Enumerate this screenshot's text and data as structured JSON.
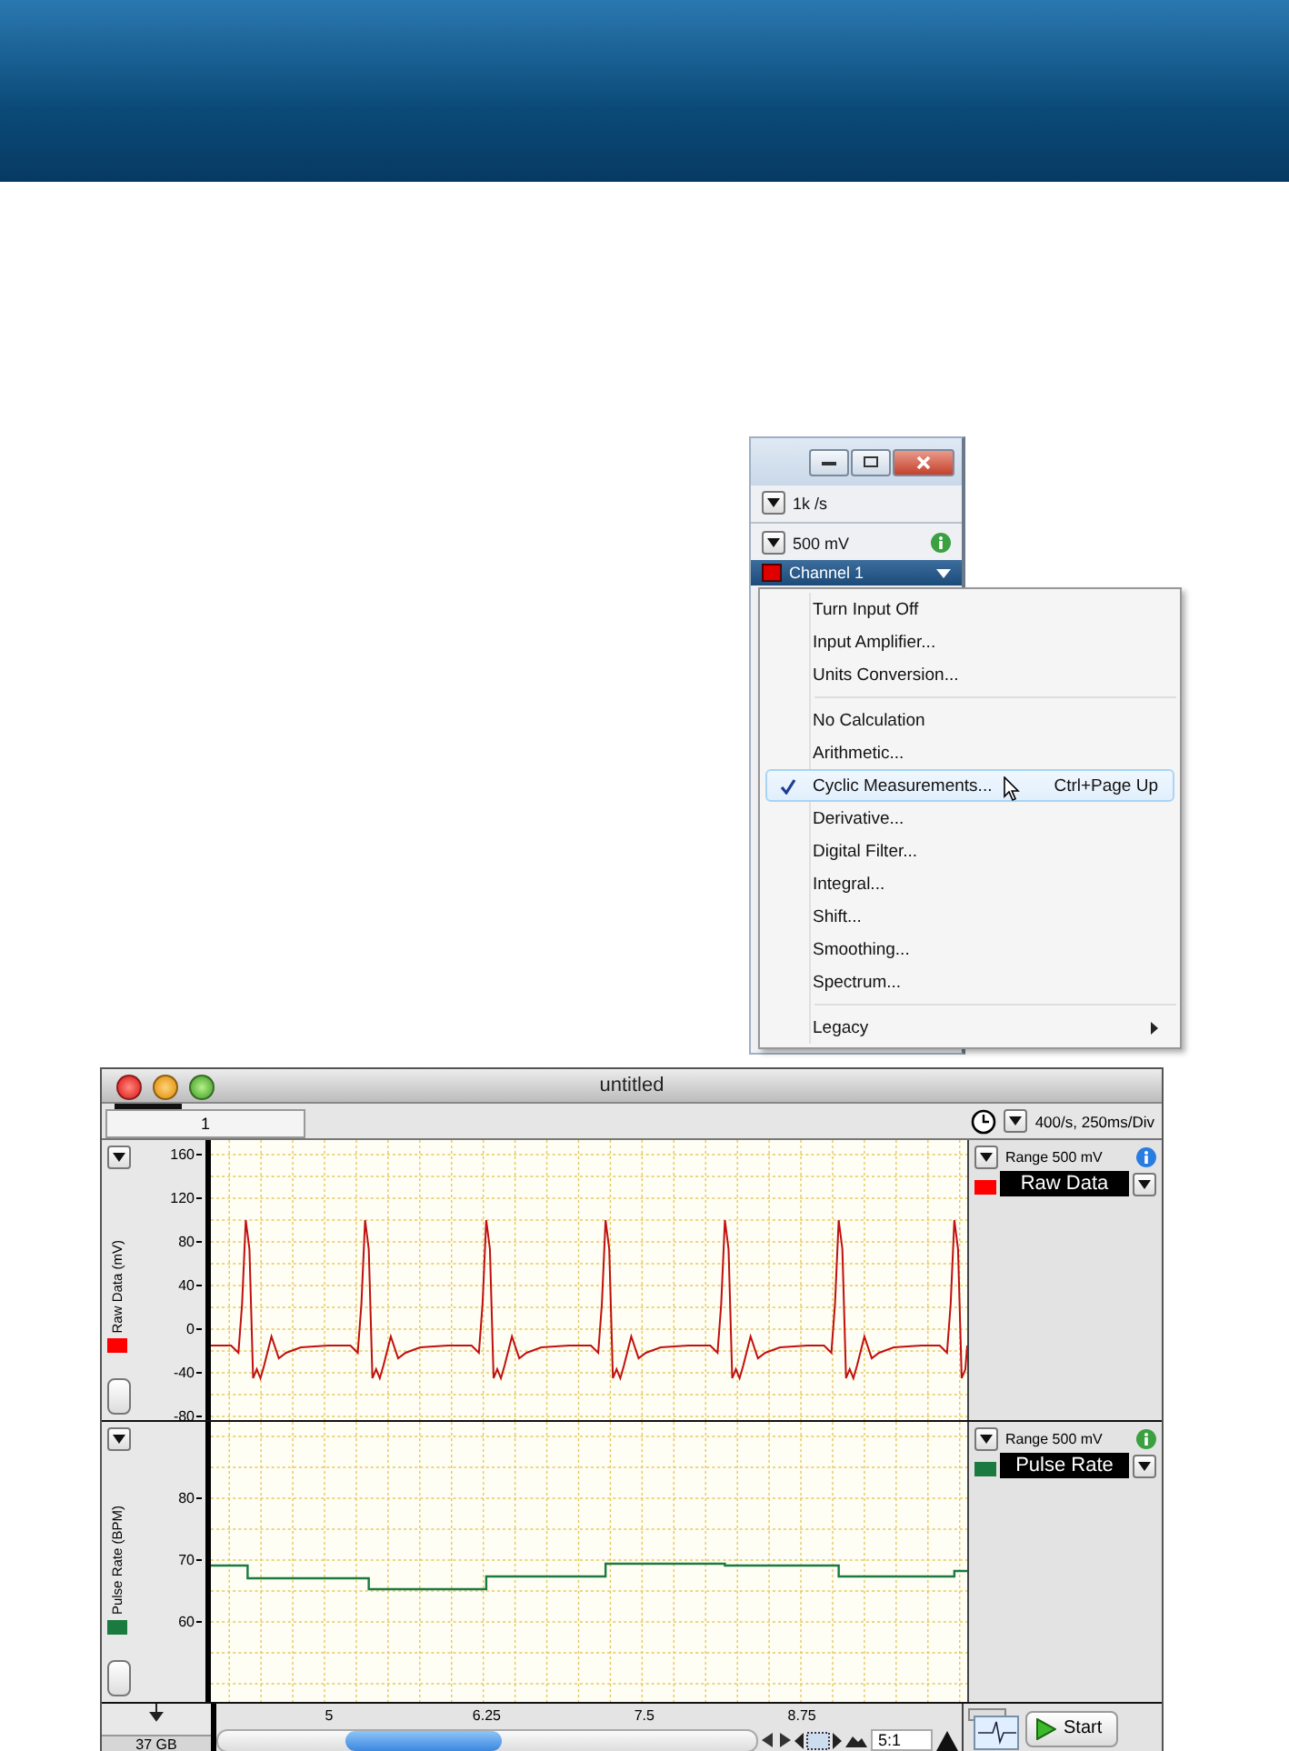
{
  "channel_panel": {
    "sample_rate": "1k /s",
    "range": "500 mV",
    "channel": {
      "name": "Channel 1",
      "color": "#e00000"
    }
  },
  "context_menu": {
    "groups": [
      [
        {
          "label": "Turn Input Off",
          "checked": false,
          "selected": false,
          "submenu": false
        },
        {
          "label": "Input Amplifier...",
          "checked": false,
          "selected": false,
          "submenu": false
        },
        {
          "label": "Units Conversion...",
          "checked": false,
          "selected": false,
          "submenu": false
        }
      ],
      [
        {
          "label": "No Calculation",
          "checked": false,
          "selected": false,
          "submenu": false
        },
        {
          "label": "Arithmetic...",
          "checked": false,
          "selected": false,
          "submenu": false
        },
        {
          "label": "Cyclic Measurements...",
          "shortcut": "Ctrl+Page Up",
          "checked": true,
          "selected": true,
          "submenu": false
        },
        {
          "label": "Derivative...",
          "checked": false,
          "selected": false,
          "submenu": false
        },
        {
          "label": "Digital Filter...",
          "checked": false,
          "selected": false,
          "submenu": false
        },
        {
          "label": "Integral...",
          "checked": false,
          "selected": false,
          "submenu": false
        },
        {
          "label": "Shift...",
          "checked": false,
          "selected": false,
          "submenu": false
        },
        {
          "label": "Smoothing...",
          "checked": false,
          "selected": false,
          "submenu": false
        },
        {
          "label": "Spectrum...",
          "checked": false,
          "selected": false,
          "submenu": false
        }
      ],
      [
        {
          "label": "Legacy",
          "checked": false,
          "selected": false,
          "submenu": true
        }
      ]
    ]
  },
  "chart_window": {
    "title": "untitled",
    "page_tab": "1",
    "rate": "400/s, 250ms/Div",
    "channels": [
      {
        "kind": "waveform",
        "axis_label": "Raw Data (mV)",
        "yticks": [
          "160",
          "120",
          "80",
          "40",
          "0",
          "-40",
          "-80"
        ],
        "range": "Range 500 mV",
        "name": "Raw Data",
        "color": "#ff0000",
        "info": {
          "color": "#2a7de0"
        }
      },
      {
        "kind": "step",
        "axis_label": "Pulse Rate (BPM)",
        "yticks": [
          "80",
          "70",
          "60"
        ],
        "range": "Range 500 mV",
        "name": "Pulse Rate",
        "color": "#1a7a40",
        "info": {
          "color": "#3aa040"
        }
      }
    ],
    "xticks": [
      "5",
      "6.25",
      "7.5",
      "8.75"
    ],
    "disk": "37 GB",
    "zoom": "5:1",
    "start_button": "Start"
  }
}
